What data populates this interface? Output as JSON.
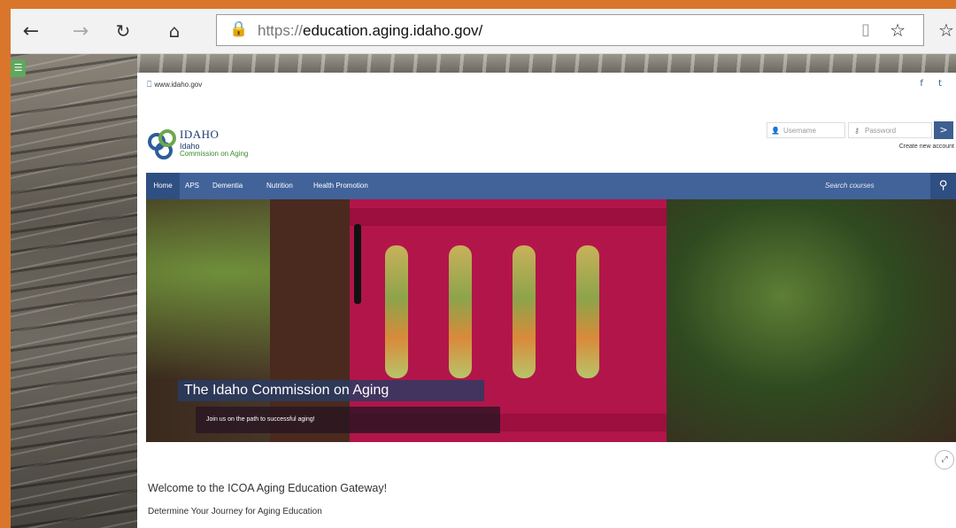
{
  "browser": {
    "back_icon": "←",
    "forward_icon": "→",
    "refresh_icon": "↻",
    "home_icon": "⌂",
    "lock_icon": "🔒",
    "url_scheme": "https://",
    "url_host": "education.aging.idaho.gov/",
    "reader_icon": "▯",
    "favorite_icon": "☆",
    "favorites_hub_icon": "☆"
  },
  "site": {
    "gov_link": "www.idaho.gov",
    "social": {
      "facebook": "f",
      "twitter": "t"
    },
    "logo": {
      "line1": "IDAHO",
      "line2": "Idaho",
      "line3": "Commission on Aging"
    },
    "login": {
      "username_placeholder": "Username",
      "password_placeholder": "Password",
      "submit_icon": ">",
      "create_account": "Create new account"
    },
    "nav": {
      "items": [
        "Home",
        "APS",
        "Dementia",
        "Nutrition",
        "Health Promotion"
      ],
      "active_index": 0,
      "search_placeholder": "Search courses"
    },
    "hero": {
      "title": "The Idaho Commission on Aging",
      "subtitle": "Join us on the path to successful aging!"
    },
    "welcome_heading": "Welcome to the ICOA Aging Education Gateway!",
    "journey_heading": "Determine Your Journey for Aging Education"
  },
  "colors": {
    "window_border": "#d9762c",
    "navbar": "#41639a",
    "navbar_active": "#2f4f82",
    "gate_red": "#b2154a"
  }
}
